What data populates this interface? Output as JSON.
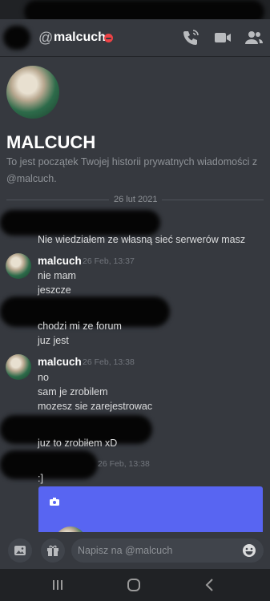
{
  "header": {
    "at_symbol": "@",
    "username": "malcuch",
    "status": "do-not-disturb",
    "icons": [
      "call-icon",
      "video-icon",
      "members-icon"
    ]
  },
  "profile": {
    "display_name": "MALCUCH",
    "intro": "To jest początek Twojej historii prywatnych wiadomości z @malcuch."
  },
  "divider_date": "26 lut 2021",
  "messages": {
    "m1": "Nie wiedziałem ze własną sieć serwerów masz",
    "g1": {
      "author": "malcuch",
      "time": "26 Feb, 13:37",
      "line1": "nie mam",
      "line2": "jeszcze"
    },
    "m2_line1": "chodzi mi ze forum",
    "m2_line2": "juz jest",
    "g2": {
      "author": "malcuch",
      "time": "26 Feb, 13:38",
      "line1": "no",
      "line2": "sam je zrobilem",
      "line3": "mozesz sie zarejestrowac"
    },
    "m3": "juz to zrobiłem xD",
    "g3": {
      "time": "26 Feb, 13:38",
      "line1": ":]"
    }
  },
  "composer": {
    "placeholder": "Napisz na @malcuch",
    "icons": [
      "image-icon",
      "gift-icon",
      "emoji-icon"
    ]
  },
  "colors": {
    "background": "#36393f",
    "accent": "#5865f2",
    "dnd": "#ed4245"
  }
}
